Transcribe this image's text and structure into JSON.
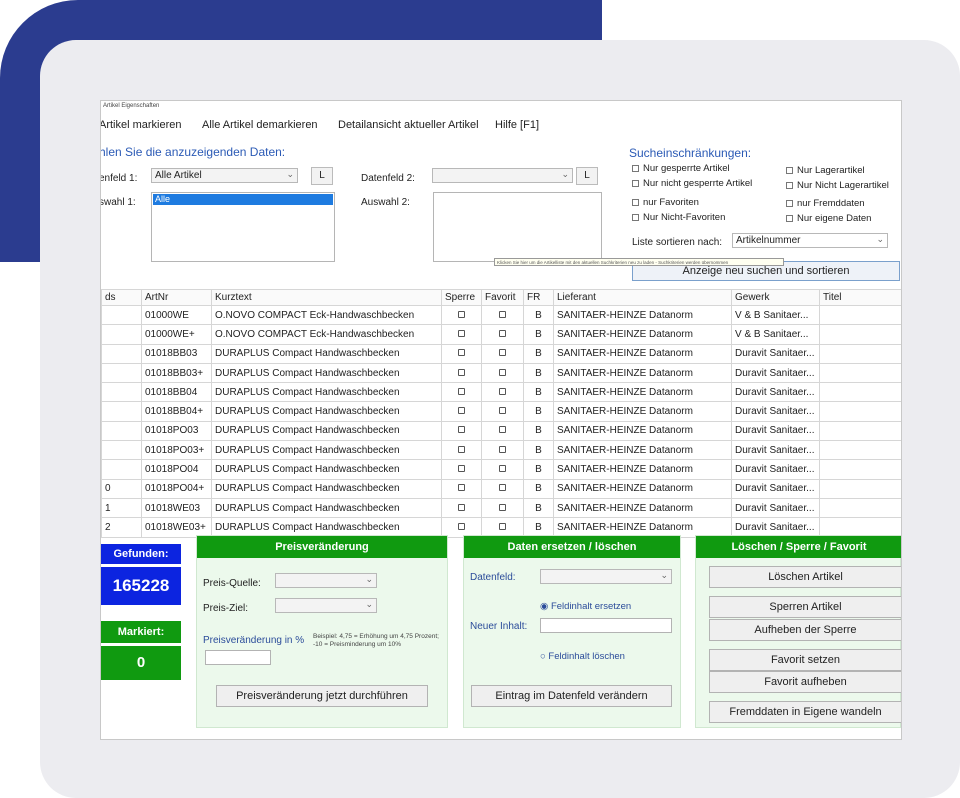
{
  "window": {
    "title": "Artikel Eigenschaften"
  },
  "menu": [
    "Artikel markieren",
    "Alle Artikel demarkieren",
    "Detailansicht aktueller Artikel",
    "Hilfe [F1]"
  ],
  "filters": {
    "heading": "hlen Sie die anzuzeigenden Daten:",
    "field1_label": "enfeld 1:",
    "field1_value": "Alle Artikel",
    "auswahl1_label": "swahl 1:",
    "auswahl1_selected": "Alle",
    "field2_label": "Datenfeld 2:",
    "field2_value": "",
    "auswahl2_label": "Auswahl 2:",
    "l_button": "L"
  },
  "restrictions": {
    "heading": "Sucheinschränkungen:",
    "left": [
      "Nur gesperrte Artikel",
      "Nur nicht gesperrte Artikel",
      "nur Favoriten",
      "Nur Nicht-Favoriten"
    ],
    "right": [
      "Nur Lagerartikel",
      "Nur Nicht Lagerartikel",
      "nur Fremddaten",
      "Nur eigene Daten"
    ],
    "sort_label": "Liste sortieren nach:",
    "sort_value": "Artikelnummer",
    "tooltip": "Klicken Sie hier um die Artikelliste mit den aktuellen Suchkriterien neu zu laden - Suchkriterien werden übernommen",
    "refresh_button": "Anzeige neu suchen und sortieren"
  },
  "table": {
    "columns": [
      "ds",
      "ArtNr",
      "Kurztext",
      "Sperre",
      "Favorit",
      "FR",
      "Lieferant",
      "Gewerk",
      "Titel"
    ],
    "rows": [
      {
        "id": "",
        "art": "01000WE",
        "text": "O.NOVO COMPACT Eck-Handwaschbecken",
        "fr": "B",
        "lief": "SANITAER-HEINZE Datanorm",
        "gew": "V & B Sanitaer..."
      },
      {
        "id": "",
        "art": "01000WE+",
        "text": "O.NOVO COMPACT Eck-Handwaschbecken",
        "fr": "B",
        "lief": "SANITAER-HEINZE Datanorm",
        "gew": "V & B Sanitaer..."
      },
      {
        "id": "",
        "art": "01018BB03",
        "text": "DURAPLUS Compact Handwaschbecken",
        "fr": "B",
        "lief": "SANITAER-HEINZE Datanorm",
        "gew": "Duravit Sanitaer..."
      },
      {
        "id": "",
        "art": "01018BB03+",
        "text": "DURAPLUS Compact Handwaschbecken",
        "fr": "B",
        "lief": "SANITAER-HEINZE Datanorm",
        "gew": "Duravit Sanitaer..."
      },
      {
        "id": "",
        "art": "01018BB04",
        "text": "DURAPLUS Compact Handwaschbecken",
        "fr": "B",
        "lief": "SANITAER-HEINZE Datanorm",
        "gew": "Duravit Sanitaer..."
      },
      {
        "id": "",
        "art": "01018BB04+",
        "text": "DURAPLUS Compact Handwaschbecken",
        "fr": "B",
        "lief": "SANITAER-HEINZE Datanorm",
        "gew": "Duravit Sanitaer..."
      },
      {
        "id": "",
        "art": "01018PO03",
        "text": "DURAPLUS Compact Handwaschbecken",
        "fr": "B",
        "lief": "SANITAER-HEINZE Datanorm",
        "gew": "Duravit Sanitaer..."
      },
      {
        "id": "",
        "art": "01018PO03+",
        "text": "DURAPLUS Compact Handwaschbecken",
        "fr": "B",
        "lief": "SANITAER-HEINZE Datanorm",
        "gew": "Duravit Sanitaer..."
      },
      {
        "id": "",
        "art": "01018PO04",
        "text": "DURAPLUS Compact Handwaschbecken",
        "fr": "B",
        "lief": "SANITAER-HEINZE Datanorm",
        "gew": "Duravit Sanitaer..."
      },
      {
        "id": "0",
        "art": "01018PO04+",
        "text": "DURAPLUS Compact Handwaschbecken",
        "fr": "B",
        "lief": "SANITAER-HEINZE Datanorm",
        "gew": "Duravit Sanitaer..."
      },
      {
        "id": "1",
        "art": "01018WE03",
        "text": "DURAPLUS Compact Handwaschbecken",
        "fr": "B",
        "lief": "SANITAER-HEINZE Datanorm",
        "gew": "Duravit Sanitaer..."
      },
      {
        "id": "2",
        "art": "01018WE03+",
        "text": "DURAPLUS Compact Handwaschbecken",
        "fr": "B",
        "lief": "SANITAER-HEINZE Datanorm",
        "gew": "Duravit Sanitaer..."
      }
    ]
  },
  "status": {
    "found_label": "Gefunden:",
    "found_value": "165228",
    "marked_label": "Markiert:",
    "marked_value": "0"
  },
  "price": {
    "header": "Preisveränderung",
    "source_label": "Preis-Quelle:",
    "target_label": "Preis-Ziel:",
    "percent_label": "Preisveränderung in %",
    "note": "Beispiel: 4,75 = Erhöhung um 4,75 Prozent; -10 = Preisminderung um 10%",
    "button": "Preisveränderung jetzt durchführen"
  },
  "replace": {
    "header": "Daten ersetzen / löschen",
    "field_label": "Datenfeld:",
    "radio_replace": "Feldinhalt ersetzen",
    "new_content_label": "Neuer Inhalt:",
    "radio_delete": "Feldinhalt löschen",
    "button": "Eintrag im Datenfeld verändern"
  },
  "actions": {
    "header": "Löschen / Sperre / Favorit",
    "buttons": [
      "Löschen Artikel",
      "Sperren Artikel",
      "Aufheben der Sperre",
      "Favorit setzen",
      "Favorit aufheben",
      "Fremddaten in Eigene wandeln"
    ]
  },
  "colors": {
    "accent_green": "#109a10",
    "status_blue": "#0c24e0",
    "heading_blue": "#2b5ab5",
    "deco_blue": "#2b3c8f"
  }
}
